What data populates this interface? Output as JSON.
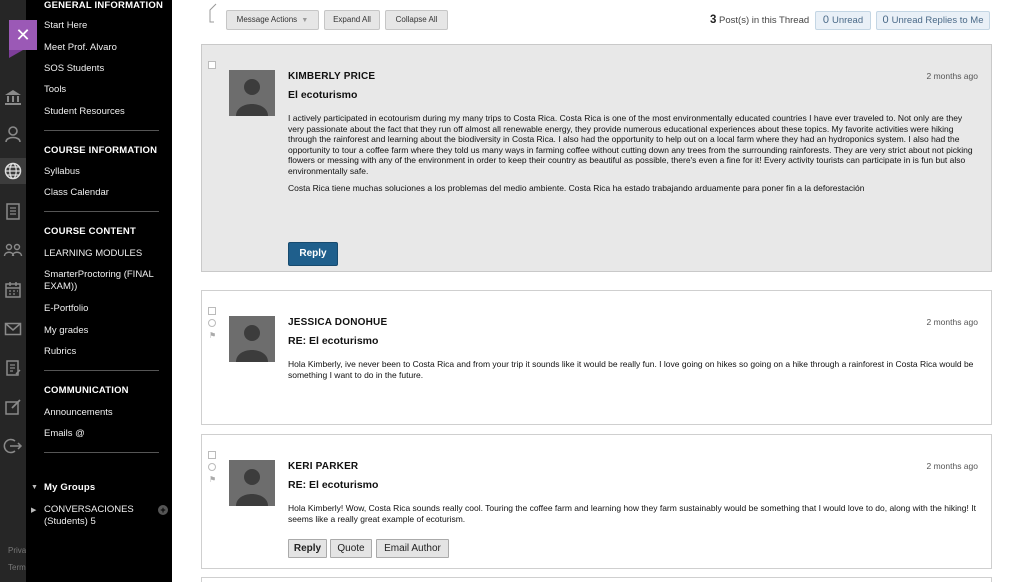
{
  "rail": {
    "footer_lines": [
      "Priva",
      "Term"
    ]
  },
  "course_menu": {
    "general": {
      "title": "GENERAL INFORMATION",
      "items": [
        "Start Here",
        "Meet Prof. Alvaro",
        "SOS Students",
        "Tools",
        "Student Resources"
      ]
    },
    "course_info": {
      "title": "COURSE INFORMATION",
      "items": [
        "Syllabus",
        "Class Calendar"
      ]
    },
    "course_content": {
      "title": "COURSE CONTENT",
      "items": [
        "LEARNING MODULES",
        "SmarterProctoring (FINAL EXAM))",
        "E-Portfolio",
        "My grades",
        "Rubrics"
      ]
    },
    "communication": {
      "title": "COMMUNICATION",
      "items": [
        "Announcements",
        "Emails @"
      ]
    },
    "my_groups": {
      "title": "My Groups",
      "group": "CONVERSACIONES (Students) 5"
    }
  },
  "toolbar": {
    "message_actions": "Message Actions",
    "expand_all": "Expand All",
    "collapse_all": "Collapse All",
    "post_count": "3",
    "post_count_label": "Post(s) in this Thread",
    "unread_count": "0",
    "unread_label": "Unread",
    "unread_replies_count": "0",
    "unread_replies_label": "Unread Replies to Me"
  },
  "posts": [
    {
      "author": "KIMBERLY PRICE",
      "subject": "El ecoturismo",
      "time": "2 months ago",
      "paragraphs": [
        "I actively participated in ecotourism during my many trips to Costa Rica. Costa Rica is one of the most environmentally educated countries I have ever traveled to. Not only are they very passionate about the fact that they run off almost all renewable energy, they provide numerous educational experiences about these topics. My favorite activities were hiking through the rainforest and learning about the biodiversity in Costa Rica. I also had the opportunity to help out on a local farm where they had an hydroponics system. I also had the opportunity to tour a coffee farm where they told us many ways in farming coffee without cutting down any trees from the surrounding rainforests. They are very strict about not picking flowers or messing with any of the environment in order to keep their country as beautiful as possible, there's even a fine for it! Every activity tourists can participate in is fun but also environmentally safe.",
        "Costa Rica tiene muchas soluciones a los problemas del medio ambiente. Costa Rica ha estado trabajando arduamente para poner fin a la deforestación"
      ],
      "reply_label": "Reply"
    },
    {
      "author": "JESSICA DONOHUE",
      "subject": "RE: El ecoturismo",
      "time": "2 months ago",
      "paragraphs": [
        "Hola Kimberly, ive never been to Costa Rica and from your trip it sounds like it would be really fun. I love going on hikes so going on a hike through a rainforest in Costa Rica would be something I want to do in the future."
      ]
    },
    {
      "author": "KERI PARKER",
      "subject": "RE: El ecoturismo",
      "time": "2 months ago",
      "paragraphs": [
        "Hola Kimberly! Wow, Costa Rica sounds really cool. Touring the coffee farm and learning how they farm sustainably would be something that I would love to do, along with the hiking! It seems like a really great example of ecoturism."
      ],
      "reply_label": "Reply",
      "quote_label": "Quote",
      "email_label": "Email Author"
    }
  ]
}
